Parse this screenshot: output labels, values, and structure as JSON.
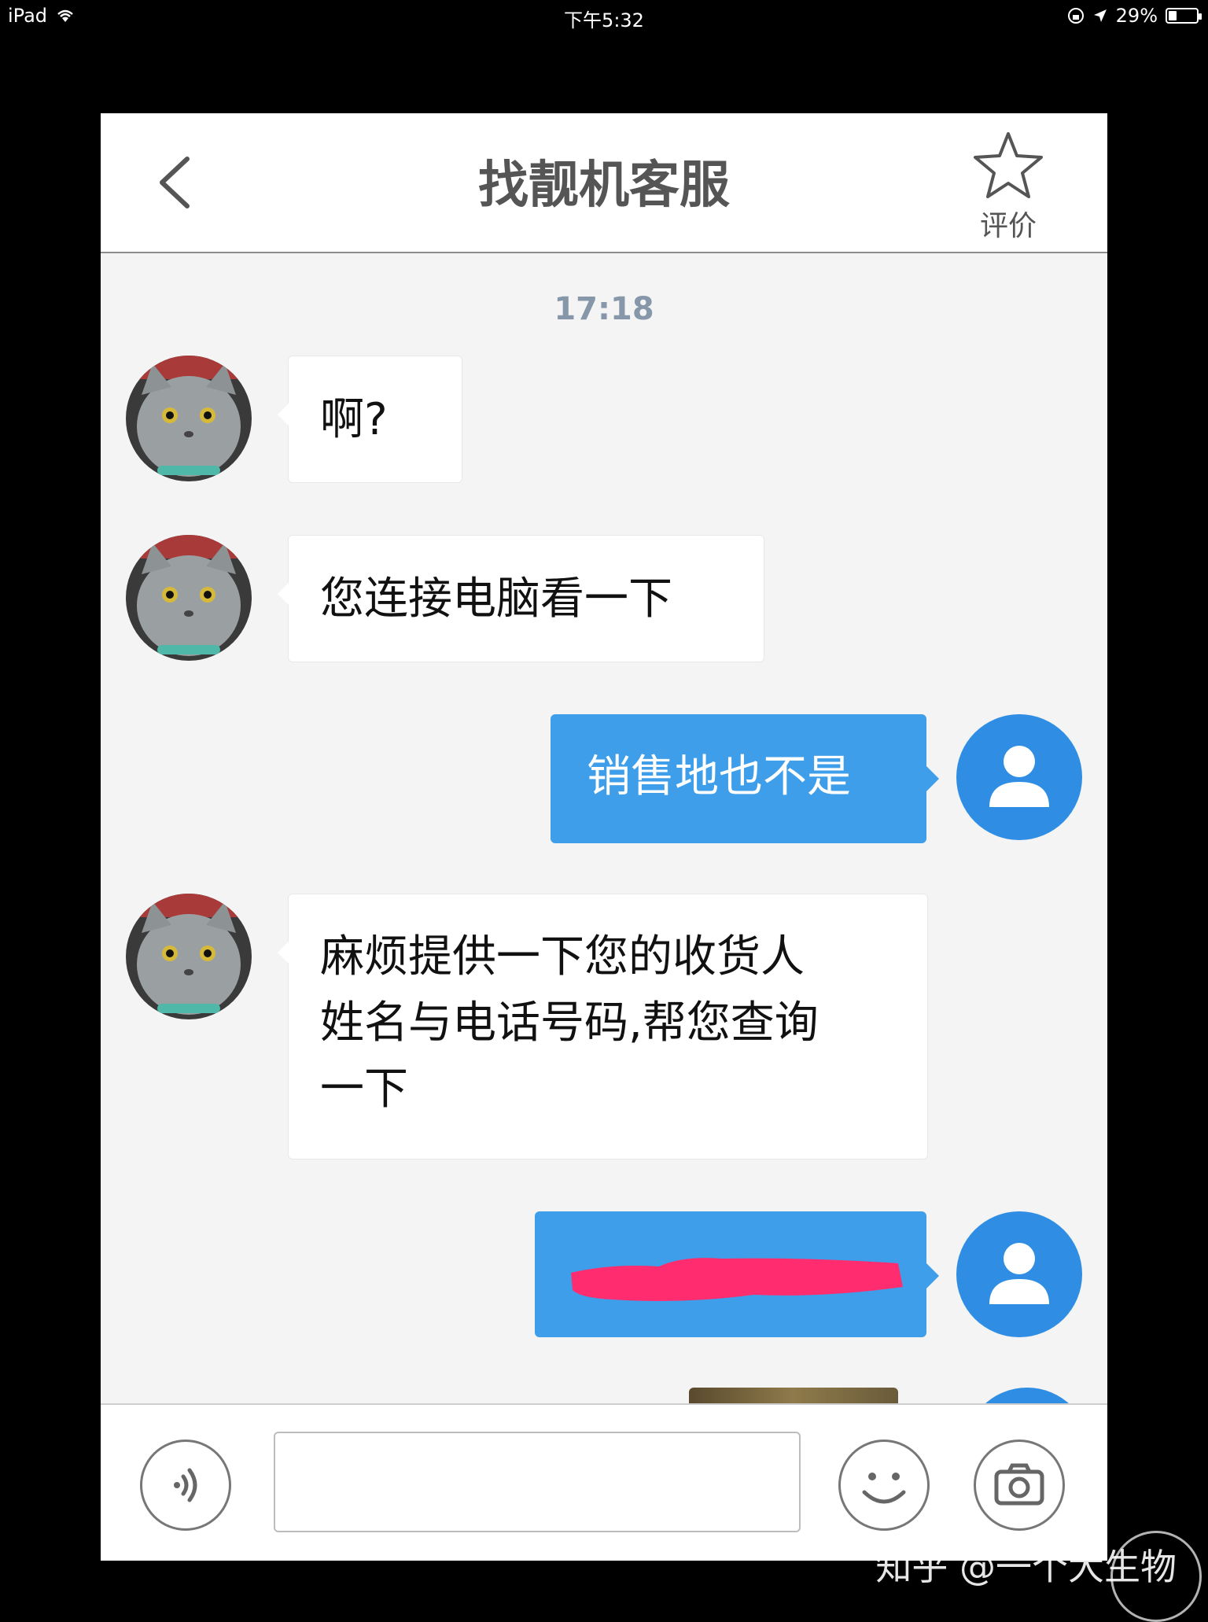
{
  "status_bar": {
    "device": "iPad",
    "time": "下午5:32",
    "battery": "29%",
    "battery_level": 0.29
  },
  "header": {
    "title": "找靓机客服",
    "rate_label": "评价"
  },
  "chat": {
    "timestamp": "17:18",
    "messages": [
      {
        "from": "agent",
        "text": "啊?"
      },
      {
        "from": "agent",
        "text": "您连接电脑看一下"
      },
      {
        "from": "user",
        "text": "销售地也不是"
      },
      {
        "from": "agent",
        "lines": [
          "麻烦提供一下您的收货人",
          "姓名与电话号码,帮您查询",
          "一下"
        ]
      },
      {
        "from": "user",
        "text": "",
        "redacted": true
      }
    ]
  },
  "watermark": {
    "text": "知乎 @一个大生物"
  },
  "colors": {
    "accent": "#3f9ee9",
    "redaction": "#ff2d6f"
  }
}
